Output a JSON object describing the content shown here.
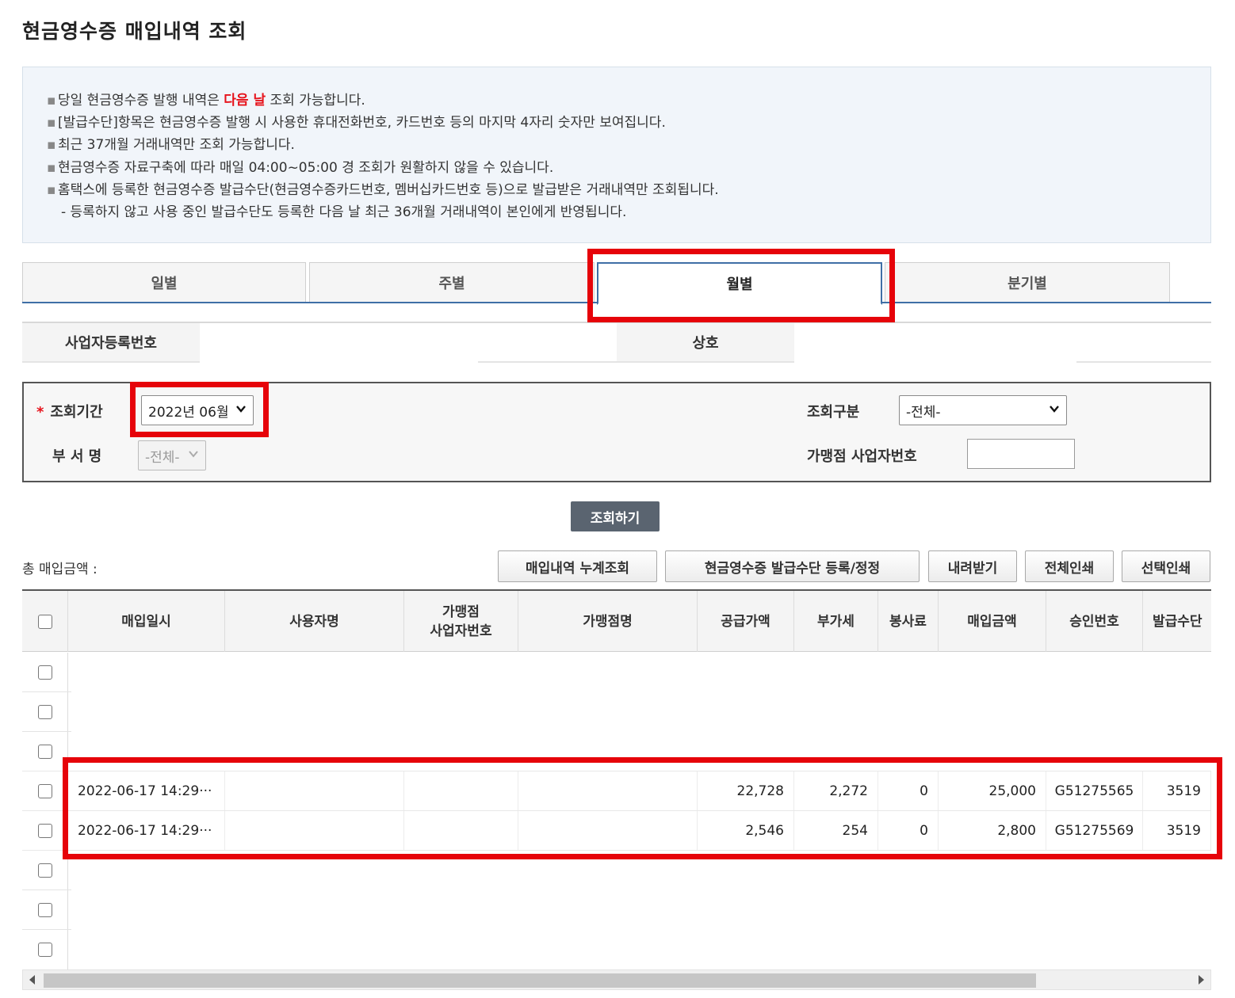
{
  "page": {
    "title": "현금영수증 매입내역 조회"
  },
  "notice": {
    "line1_pre": "당일 현금영수증 발행 내역은 ",
    "line1_red": "다음 날",
    "line1_post": " 조회 가능합니다.",
    "line2": "[발급수단]항목은 현금영수증 발행 시 사용한 휴대전화번호, 카드번호 등의 마지막 4자리 숫자만 보여집니다.",
    "line3": "최근 37개월 거래내역만 조회 가능합니다.",
    "line4": "현금영수증 자료구축에 따라 매일 04:00~05:00 경 조회가 원활하지 않을 수 있습니다.",
    "line5": "홈택스에 등록한 현금영수증 발급수단(현금영수증카드번호, 멤버십카드번호 등)으로 발급받은 거래내역만 조회됩니다.",
    "line6": "- 등록하지 않고 사용 중인 발급수단도 등록한 다음 날 최근 36개월 거래내역이 본인에게 반영됩니다.",
    "bullet": "▪"
  },
  "tabs": [
    {
      "label": "일별"
    },
    {
      "label": "주별"
    },
    {
      "label": "월별",
      "active": true
    },
    {
      "label": "분기별"
    }
  ],
  "biz": {
    "reg_no_label": "사업자등록번호",
    "name_label": "상호"
  },
  "search": {
    "period_label": "조회기간",
    "required_mark": "*",
    "period_value": "2022년 06월",
    "type_label": "조회구분",
    "type_value": "-전체-",
    "dept_label": "부 서 명",
    "dept_value": "-전체-",
    "merchant_label": "가맹점 사업자번호",
    "merchant_value": ""
  },
  "buttons": {
    "search": "조회하기",
    "cumulative": "매입내역 누계조회",
    "register": "현금영수증 발급수단 등록/정정",
    "download": "내려받기",
    "print_all": "전체인쇄",
    "print_selected": "선택인쇄"
  },
  "total": {
    "label": "총 매입금액 :"
  },
  "table": {
    "headers": {
      "date": "매입일시",
      "user": "사용자명",
      "merchant_no_1": "가맹점",
      "merchant_no_2": "사업자번호",
      "merchant_name": "가맹점명",
      "supply": "공급가액",
      "vat": "부가세",
      "service": "봉사료",
      "amount": "매입금액",
      "approval": "승인번호",
      "issue_means": "발급수단"
    },
    "rows": [
      {
        "date": "2022-06-17 14:29···",
        "user": "",
        "merchant_no": "",
        "merchant_name": "",
        "supply": "22,728",
        "vat": "2,272",
        "service": "0",
        "amount": "25,000",
        "approval": "G51275565",
        "issue_means": "3519"
      },
      {
        "date": "2022-06-17 14:29···",
        "user": "",
        "merchant_no": "",
        "merchant_name": "",
        "supply": "2,546",
        "vat": "254",
        "service": "0",
        "amount": "2,800",
        "approval": "G51275569",
        "issue_means": "3519"
      }
    ]
  },
  "colors": {
    "highlight": "#e6030a",
    "tab_active_border": "#3f6fa6",
    "search_button": "#5a6470",
    "notice_red": "#e6121b"
  },
  "icons": {
    "dropdown": "chevron-down-icon",
    "scroll_left": "arrow-left-icon",
    "scroll_right": "arrow-right-icon"
  }
}
